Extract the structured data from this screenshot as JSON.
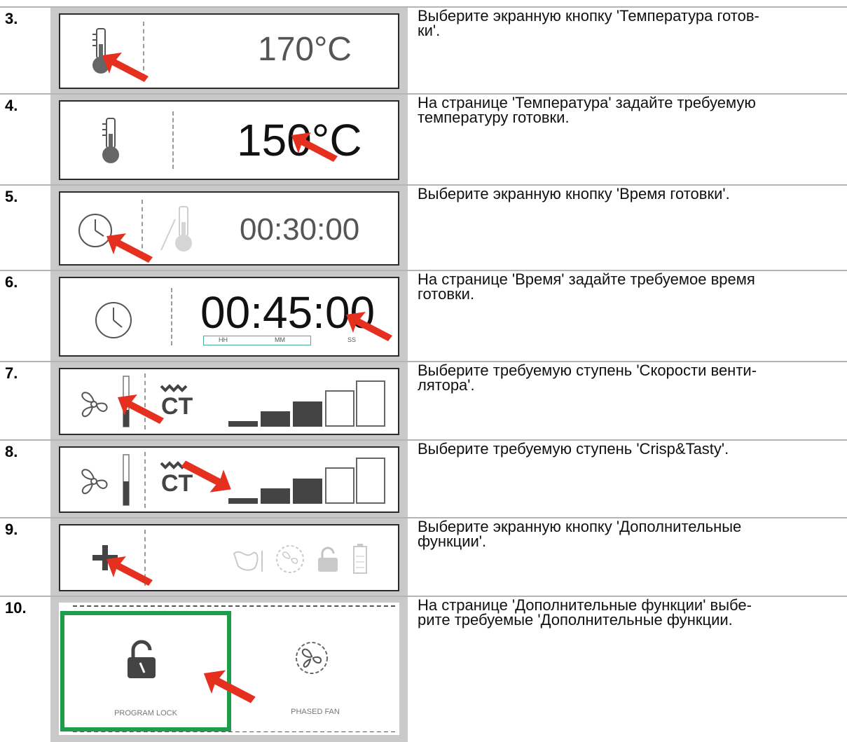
{
  "steps": [
    {
      "num": "3.",
      "desc": [
        "Выберите экранную кнопку 'Температура готов-",
        "ки'."
      ],
      "screen_value": "170°C"
    },
    {
      "num": "4.",
      "desc": [
        "На странице 'Температура' задайте требуемую",
        "температуру готовки."
      ],
      "screen_value": "150°C"
    },
    {
      "num": "5.",
      "desc": [
        "Выберите экранную кнопку 'Время готовки'."
      ],
      "screen_value": "00:30:00"
    },
    {
      "num": "6.",
      "desc": [
        "На странице 'Время' задайте требуемое время",
        "готовки."
      ],
      "screen_value": "00:45:00",
      "time_labels": [
        "HH",
        "MM",
        "SS"
      ]
    },
    {
      "num": "7.",
      "desc": [
        "Выберите требуемую ступень 'Скорости венти-",
        "лятора'."
      ],
      "logo_text": "CT"
    },
    {
      "num": "8.",
      "desc": [
        "Выберите требуемую ступень 'Crisp&Tasty'."
      ],
      "logo_text": "CT"
    },
    {
      "num": "9.",
      "desc": [
        "Выберите экранную кнопку 'Дополнительные",
        "функции'."
      ]
    },
    {
      "num": "10.",
      "desc": [
        "На странице 'Дополнительные функции' выбе-",
        "рите требуемые 'Дополнительные функции."
      ],
      "options": [
        "PROGRAM LOCK",
        "PHASED FAN"
      ]
    }
  ],
  "colors": {
    "arrow": "#e53020",
    "highlight": "#1e9e4a",
    "bar": "#444444",
    "separator": "#b5b5b5"
  },
  "icons": [
    "thermometer-icon",
    "clock-icon",
    "fan-icon",
    "plus-icon",
    "lock-icon",
    "arrow-pointer-icon"
  ]
}
